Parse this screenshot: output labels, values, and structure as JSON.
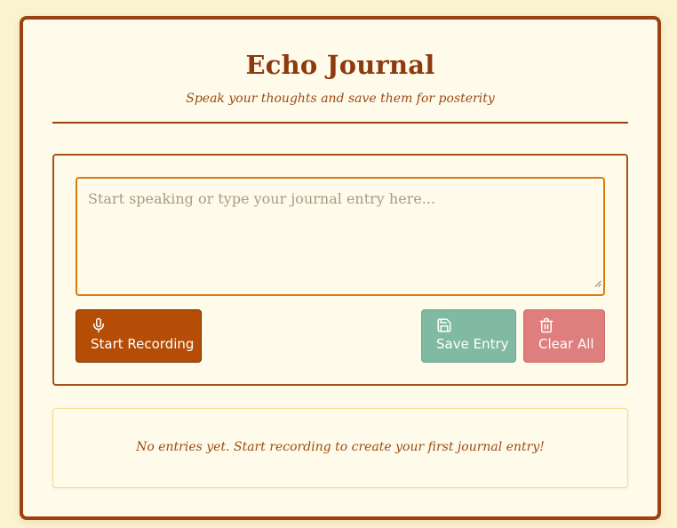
{
  "app": {
    "title": "Echo Journal",
    "subtitle": "Speak your thoughts and save them for posterity"
  },
  "editor": {
    "value": "",
    "placeholder": "Start speaking or type your journal entry here..."
  },
  "buttons": {
    "record": {
      "label": "Start Recording",
      "icon": "microphone-icon"
    },
    "save": {
      "label": "Save Entry",
      "icon": "save-icon"
    },
    "clear": {
      "label": "Clear All",
      "icon": "trash-icon"
    }
  },
  "entries": {
    "items": [],
    "empty_message": "No entries yet. Start recording to create your first journal entry!"
  },
  "colors": {
    "background": "#fbf2cf",
    "card": "#fffbeb",
    "border": "#9c4212",
    "accent_text": "#8c3a0e",
    "input_border": "#d97b0e",
    "record_button": "#b54d07",
    "save_button": "#80baa2",
    "clear_button": "#de7e7d"
  }
}
